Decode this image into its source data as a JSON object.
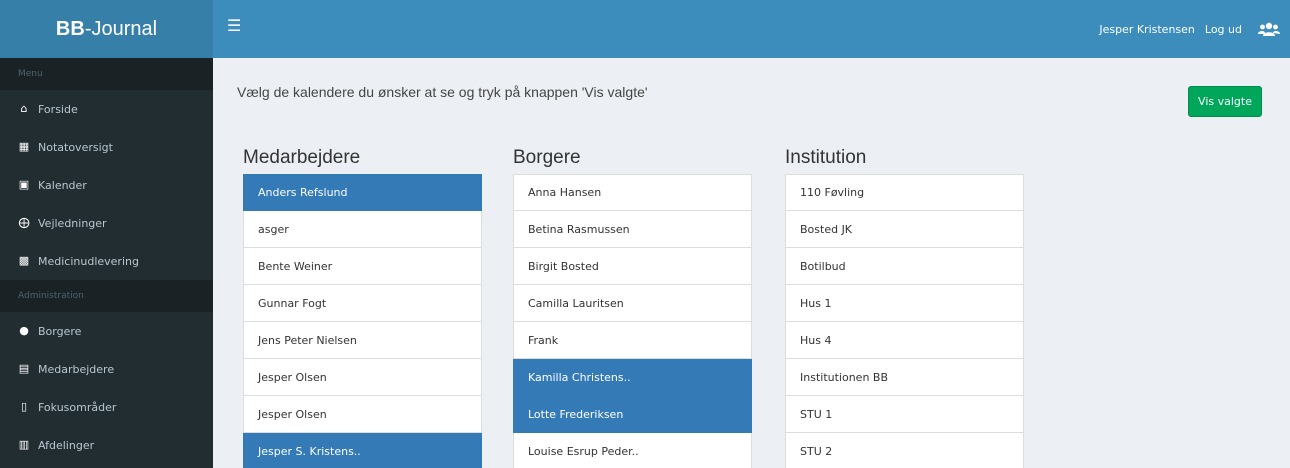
{
  "app": {
    "logo_bold": "BB",
    "logo_rest": "-Journal",
    "accent": "#3c8dbc",
    "sidebar_bg": "#222d32"
  },
  "topbar": {
    "menu_icon": "hamburger-icon",
    "user_name": "Jesper Kristensen",
    "logout": "Log ud",
    "users_icon": "users-icon"
  },
  "sidebar": {
    "menu_header": "Menu",
    "admin_header": "Administration",
    "menu_items": [
      {
        "label": "Forside",
        "icon": "home-icon"
      },
      {
        "label": "Notatoversigt",
        "icon": "note-icon"
      },
      {
        "label": "Kalender",
        "icon": "calendar-icon"
      },
      {
        "label": "Vejledninger",
        "icon": "help-icon"
      },
      {
        "label": "Medicinudlevering",
        "icon": "medicine-icon"
      }
    ],
    "admin_items": [
      {
        "label": "Borgere",
        "icon": "user-icon"
      },
      {
        "label": "Medarbejdere",
        "icon": "id-card-icon"
      },
      {
        "label": "Fokusområder",
        "icon": "clipboard-icon"
      },
      {
        "label": "Afdelinger",
        "icon": "building-icon"
      }
    ]
  },
  "main": {
    "instruction": "Vælg de kalendere du ønsker at se og tryk på knappen 'Vis valgte'",
    "show_button": "Vis valgte",
    "show_button_color": "#00a65a",
    "selected_color": "#337ab7",
    "columns": [
      {
        "title": "Medarbejdere",
        "items": [
          {
            "label": "Anders Refslund",
            "selected": true
          },
          {
            "label": "asger",
            "selected": false
          },
          {
            "label": "Bente Weiner",
            "selected": false
          },
          {
            "label": "Gunnar Fogt",
            "selected": false
          },
          {
            "label": "Jens Peter Nielsen",
            "selected": false
          },
          {
            "label": "Jesper Olsen",
            "selected": false
          },
          {
            "label": "Jesper Olsen",
            "selected": false
          },
          {
            "label": "Jesper S. Kristens..",
            "selected": true
          }
        ]
      },
      {
        "title": "Borgere",
        "items": [
          {
            "label": "Anna Hansen",
            "selected": false
          },
          {
            "label": "Betina Rasmussen",
            "selected": false
          },
          {
            "label": "Birgit Bosted",
            "selected": false
          },
          {
            "label": "Camilla Lauritsen",
            "selected": false
          },
          {
            "label": "Frank",
            "selected": false
          },
          {
            "label": "Kamilla Christens..",
            "selected": true
          },
          {
            "label": "Lotte Frederiksen",
            "selected": true
          },
          {
            "label": "Louise Esrup Peder..",
            "selected": false
          }
        ]
      },
      {
        "title": "Institution",
        "items": [
          {
            "label": "110 Føvling",
            "selected": false
          },
          {
            "label": "Bosted JK",
            "selected": false
          },
          {
            "label": "Botilbud",
            "selected": false
          },
          {
            "label": "Hus 1",
            "selected": false
          },
          {
            "label": "Hus 4",
            "selected": false
          },
          {
            "label": "Institutionen BB",
            "selected": false
          },
          {
            "label": "STU 1",
            "selected": false
          },
          {
            "label": "STU 2",
            "selected": false
          }
        ]
      }
    ]
  }
}
